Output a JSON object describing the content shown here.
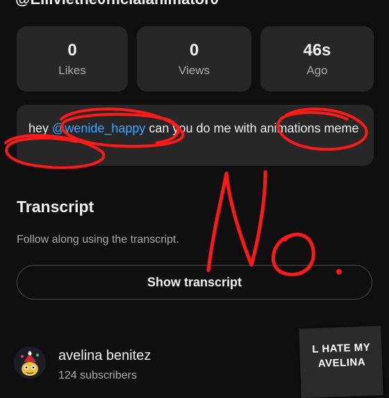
{
  "header": {
    "channel_handle": "@Elliviethe0fficialanimator0"
  },
  "stats": [
    {
      "value": "0",
      "label": "Likes"
    },
    {
      "value": "0",
      "label": "Views"
    },
    {
      "value": "46s",
      "label": "Ago"
    }
  ],
  "description": {
    "prefix": "hey ",
    "mention": "@wenide_happy",
    "suffix": " can you do me with animations meme"
  },
  "transcript": {
    "title": "Transcript",
    "subtitle": "Follow along using the transcript.",
    "button_label": "Show transcript"
  },
  "channel": {
    "name": "avelina benitez",
    "subscribers": "124 subscribers"
  },
  "sticker": {
    "line1": "L HATE MY",
    "line2": "AVELINA"
  },
  "annotation": {
    "scribble_text": "No.",
    "color": "#ff1a1a"
  },
  "colors": {
    "background": "#0f0f0f",
    "card": "#272727",
    "link": "#3ea6ff",
    "secondary_text": "#aaaaaa"
  }
}
